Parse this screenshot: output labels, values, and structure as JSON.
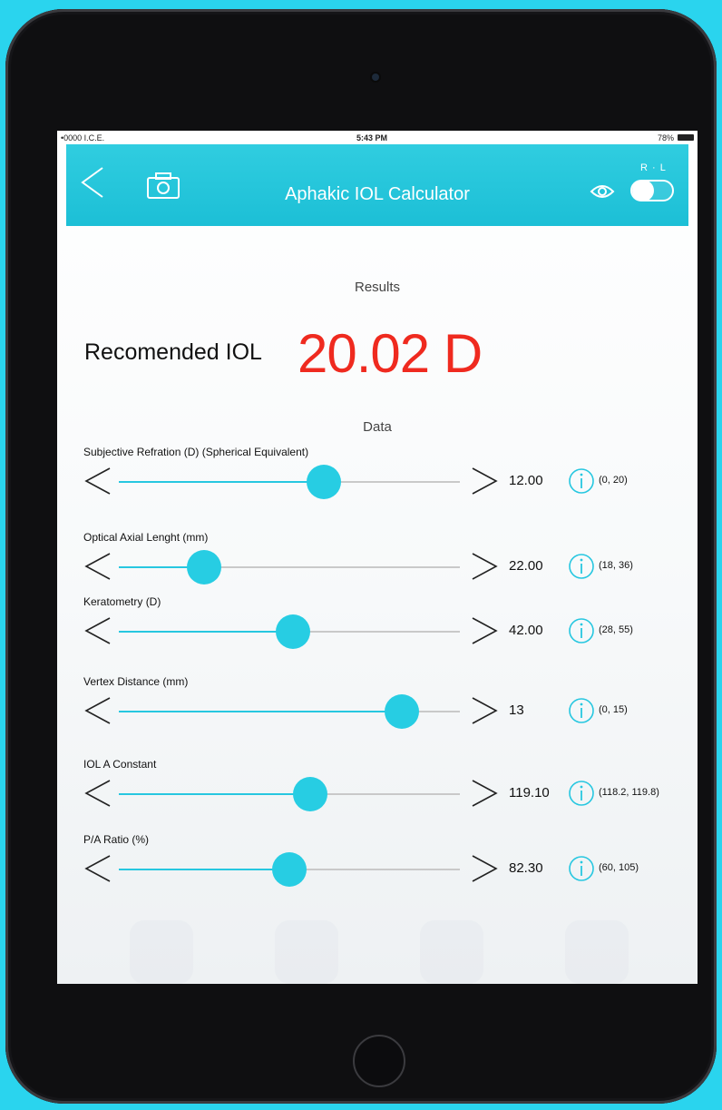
{
  "status_bar": {
    "carrier": "•0000 I.C.E.",
    "time": "5:43 PM",
    "battery": "78%"
  },
  "nav": {
    "title": "Aphakic IOL Calculator",
    "toggle_label": "R · L"
  },
  "results": {
    "section_label": "Results",
    "recommended_label": "Recomended IOL",
    "recommended_value": "20.02 D"
  },
  "data_section": {
    "label": "Data",
    "params": [
      {
        "label": "Subjective Refration (D) (Spherical Equivalent)",
        "value": "12.00",
        "range": "(0, 20)",
        "level": 0.6
      },
      {
        "label": "Optical Axial Lenght (mm)",
        "value": "22.00",
        "range": "(18, 36)",
        "level": 0.25
      },
      {
        "label": "Keratometry (D)",
        "value": "42.00",
        "range": "(28, 55)",
        "level": 0.51
      },
      {
        "label": "Vertex Distance (mm)",
        "value": "13",
        "range": "(0, 15)",
        "level": 0.83
      },
      {
        "label": "IOL A Constant",
        "value": "119.10",
        "range": "(118.2, 119.8)",
        "level": 0.56
      },
      {
        "label": "P/A Ratio (%)",
        "value": "82.30",
        "range": "(60, 105)",
        "level": 0.5
      }
    ]
  },
  "colors": {
    "accent": "#27cde3",
    "result": "#ef2a1f",
    "background": "#2ad4ee"
  },
  "icons": {
    "back": "chevron-left-icon",
    "camera": "camera-icon",
    "eye": "eye-icon",
    "decrease": "chevron-left-icon",
    "increase": "chevron-right-icon",
    "info": "info-icon"
  }
}
